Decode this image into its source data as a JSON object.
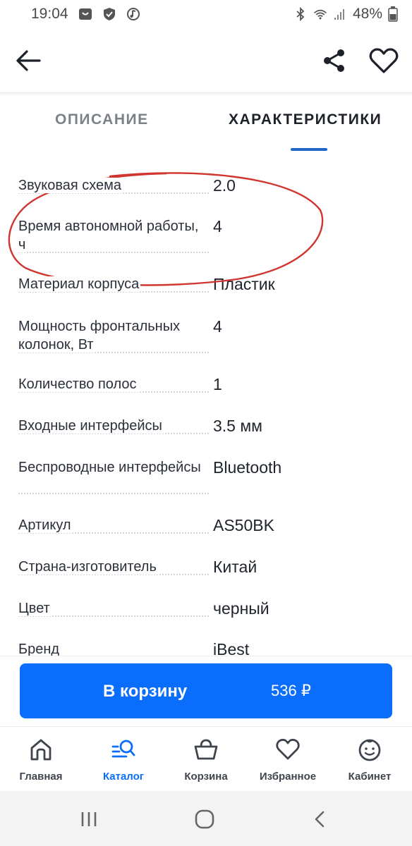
{
  "status_bar": {
    "time": "19:04",
    "battery": "48%"
  },
  "header": {
    "back_icon": "arrow-left-icon",
    "share_icon": "share-icon",
    "favorite_icon": "heart-icon"
  },
  "tabs": [
    {
      "label": "ОПИСАНИЕ",
      "active": false
    },
    {
      "label": "ХАРАКТЕРИСТИКИ",
      "active": true
    }
  ],
  "specs": [
    {
      "name": "Звуковая схема",
      "value": "2.0"
    },
    {
      "name": "Время автономной работы, ч",
      "value": "4"
    },
    {
      "name": "Материал корпуса",
      "value": "Пластик"
    },
    {
      "name": "Мощность фронтальных колонок, Вт",
      "value": "4"
    },
    {
      "name": "Количество полос",
      "value": "1"
    },
    {
      "name": "Входные интерфейсы",
      "value": "3.5 мм"
    },
    {
      "name": "Беспроводные интерфейсы",
      "value": "Bluetooth"
    },
    {
      "name": "Артикул",
      "value": "AS50BK"
    },
    {
      "name": "Страна-изготовитель",
      "value": "Китай"
    },
    {
      "name": "Цвет",
      "value": "черный"
    },
    {
      "name": "Бренд",
      "value": "iBest"
    }
  ],
  "cart": {
    "label": "В корзину",
    "price": "536 ₽"
  },
  "bottom_nav": [
    {
      "label": "Главная",
      "icon": "home-icon",
      "active": false
    },
    {
      "label": "Каталог",
      "icon": "catalog-search-icon",
      "active": true
    },
    {
      "label": "Корзина",
      "icon": "basket-icon",
      "active": false
    },
    {
      "label": "Избранное",
      "icon": "heart-icon",
      "active": false
    },
    {
      "label": "Кабинет",
      "icon": "smile-face-icon",
      "active": false
    }
  ],
  "colors": {
    "accent": "#0b6dfc",
    "tab_underline": "#2366c9",
    "annotation": "#d0352f"
  }
}
